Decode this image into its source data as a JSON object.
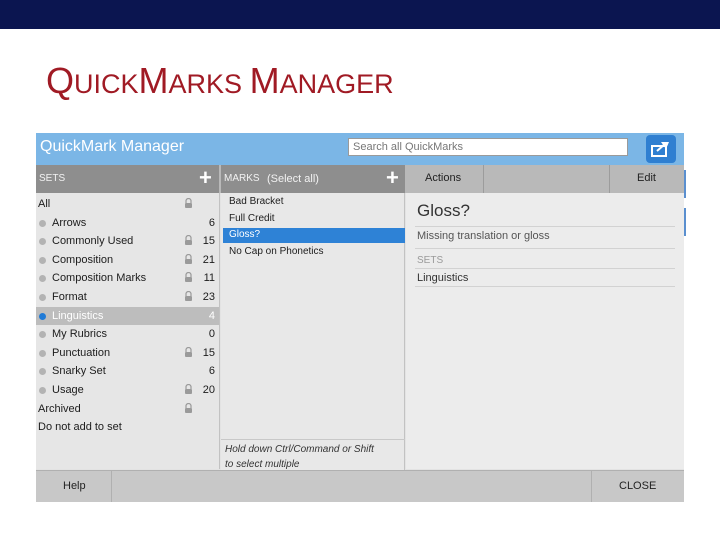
{
  "slide": {
    "title_cap1": "Q",
    "title_rest1": "UICK",
    "title_cap2": "M",
    "title_rest2": "ARKS ",
    "title_cap3": "M",
    "title_rest3": "ANAGER"
  },
  "app": {
    "title": "QuickMark Manager",
    "search_placeholder": "Search all QuickMarks"
  },
  "columns": {
    "sets_label": "SETS",
    "marks_label": "MARKS",
    "select_all": "(Select all)",
    "actions": "Actions",
    "edit": "Edit"
  },
  "sets": [
    {
      "label": "All",
      "count": "",
      "locked": true,
      "dot": false,
      "selected": false
    },
    {
      "label": "Arrows",
      "count": "6",
      "locked": false,
      "dot": true,
      "selected": false
    },
    {
      "label": "Commonly Used",
      "count": "15",
      "locked": true,
      "dot": true,
      "selected": false
    },
    {
      "label": "Composition",
      "count": "21",
      "locked": true,
      "dot": true,
      "selected": false
    },
    {
      "label": "Composition Marks",
      "count": "11",
      "locked": true,
      "dot": true,
      "selected": false
    },
    {
      "label": "Format",
      "count": "23",
      "locked": true,
      "dot": true,
      "selected": false
    },
    {
      "label": "Linguistics",
      "count": "4",
      "locked": false,
      "dot": true,
      "selected": true
    },
    {
      "label": "My Rubrics",
      "count": "0",
      "locked": false,
      "dot": true,
      "selected": false
    },
    {
      "label": "Punctuation",
      "count": "15",
      "locked": true,
      "dot": true,
      "selected": false
    },
    {
      "label": "Snarky Set",
      "count": "6",
      "locked": false,
      "dot": true,
      "selected": false
    },
    {
      "label": "Usage",
      "count": "20",
      "locked": true,
      "dot": true,
      "selected": false
    },
    {
      "label": "Archived",
      "count": "",
      "locked": true,
      "dot": false,
      "selected": false
    },
    {
      "label": "Do not add to set",
      "count": "",
      "locked": false,
      "dot": false,
      "selected": false
    }
  ],
  "marks": [
    {
      "label": "Bad Bracket",
      "selected": false
    },
    {
      "label": "Full Credit",
      "selected": false
    },
    {
      "label": "Gloss?",
      "selected": true
    },
    {
      "label": "No Cap on Phonetics",
      "selected": false
    }
  ],
  "hint": {
    "line1": "Hold down Ctrl/Command or Shift",
    "line2": "to select multiple"
  },
  "detail": {
    "title": "Gloss?",
    "text": "Missing translation or gloss",
    "sets_label": "SETS",
    "set_name": "Linguistics"
  },
  "footer": {
    "help": "Help",
    "close": "CLOSE"
  },
  "colors": {
    "top_bar": "#0b1550",
    "title_red": "#a01a24",
    "header_blue": "#7bb6e6",
    "selection_blue": "#2e82d6"
  }
}
